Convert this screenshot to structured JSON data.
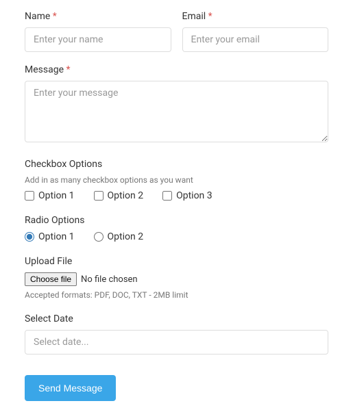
{
  "name": {
    "label": "Name",
    "required": "*",
    "placeholder": "Enter your name"
  },
  "email": {
    "label": "Email",
    "required": "*",
    "placeholder": "Enter your email"
  },
  "message": {
    "label": "Message",
    "required": "*",
    "placeholder": "Enter your message"
  },
  "checkbox": {
    "label": "Checkbox Options",
    "helper": "Add in as many checkbox options as you want",
    "options": [
      "Option 1",
      "Option 2",
      "Option 3"
    ]
  },
  "radio": {
    "label": "Radio Options",
    "options": [
      "Option 1",
      "Option 2"
    ]
  },
  "upload": {
    "label": "Upload File",
    "button": "Choose file",
    "status": "No file chosen",
    "helper": "Accepted formats: PDF, DOC, TXT - 2MB limit"
  },
  "date": {
    "label": "Select Date",
    "placeholder": "Select date..."
  },
  "submit": {
    "label": "Send Message"
  }
}
